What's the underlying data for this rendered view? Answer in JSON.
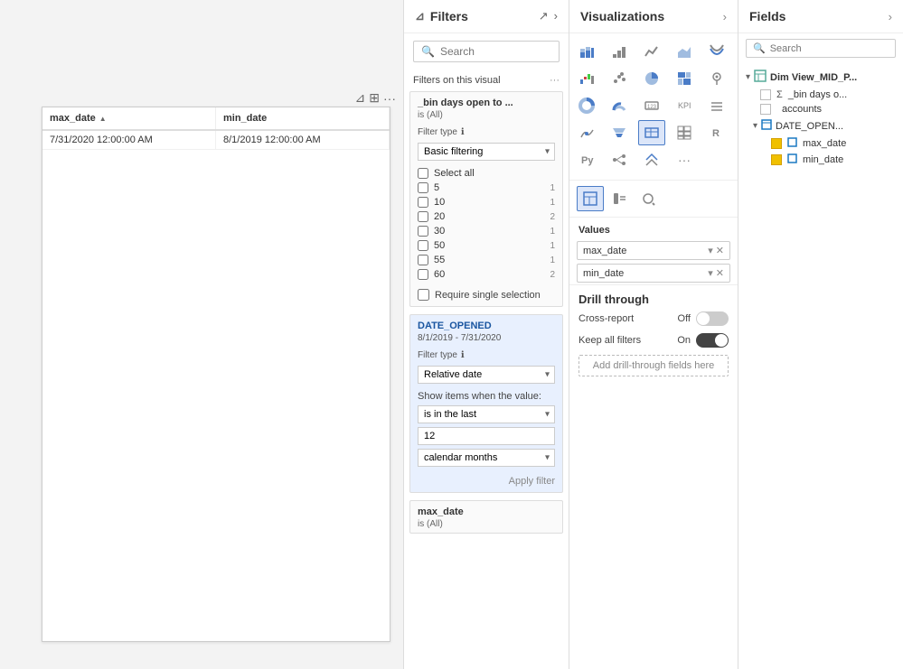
{
  "canvas": {
    "table": {
      "columns": [
        {
          "name": "max_date",
          "sort": "▲"
        },
        {
          "name": "min_date"
        }
      ],
      "rows": [
        {
          "max_date": "7/31/2020 12:00:00 AM",
          "min_date": "8/1/2019 12:00:00 AM"
        }
      ]
    }
  },
  "filters": {
    "title": "Filters",
    "search_placeholder": "Search",
    "on_this_visual_label": "Filters on this visual",
    "card1": {
      "header": "_bin days open to ...",
      "sub": "is (All)",
      "filter_type_label": "Filter type",
      "filter_type_value": "Basic filtering",
      "select_all_label": "Select all",
      "items": [
        {
          "label": "5",
          "count": "1"
        },
        {
          "label": "10",
          "count": "1"
        },
        {
          "label": "20",
          "count": "2"
        },
        {
          "label": "30",
          "count": "1"
        },
        {
          "label": "50",
          "count": "1"
        },
        {
          "label": "55",
          "count": "1"
        },
        {
          "label": "60",
          "count": "2"
        }
      ],
      "require_single_label": "Require single selection"
    },
    "card2": {
      "header": "DATE_OPENED",
      "sub": "8/1/2019 - 7/31/2020",
      "filter_type_label": "Filter type",
      "filter_type_value": "Relative date",
      "show_items_label": "Show items when the value:",
      "condition1": "is in the last",
      "value": "12",
      "condition2": "calendar months",
      "apply_btn": "Apply filter"
    },
    "card3": {
      "header": "max_date",
      "sub": "is (All)"
    }
  },
  "visualizations": {
    "title": "Visualizations",
    "values_label": "Values",
    "fields": [
      {
        "name": "max_date"
      },
      {
        "name": "min_date"
      }
    ],
    "drill_through": {
      "title": "Drill through",
      "cross_report": {
        "label": "Cross-report",
        "state": "Off"
      },
      "keep_all_filters": {
        "label": "Keep all filters",
        "state": "On"
      },
      "add_field_label": "Add drill-through fields here"
    }
  },
  "fields": {
    "title": "Fields",
    "search_placeholder": "Search",
    "tree": {
      "group1": {
        "name": "Dim View_MID_P...",
        "expanded": true,
        "items": [
          {
            "label": "_bin days o...",
            "type": "sigma",
            "checked": false
          },
          {
            "label": "accounts",
            "type": "field",
            "checked": false
          },
          {
            "subgroup": "DATE_OPEN...",
            "expanded": true,
            "subitems": [
              {
                "label": "max_date",
                "type": "table",
                "checked": true
              },
              {
                "label": "min_date",
                "type": "table",
                "checked": true
              }
            ]
          }
        ]
      }
    }
  }
}
